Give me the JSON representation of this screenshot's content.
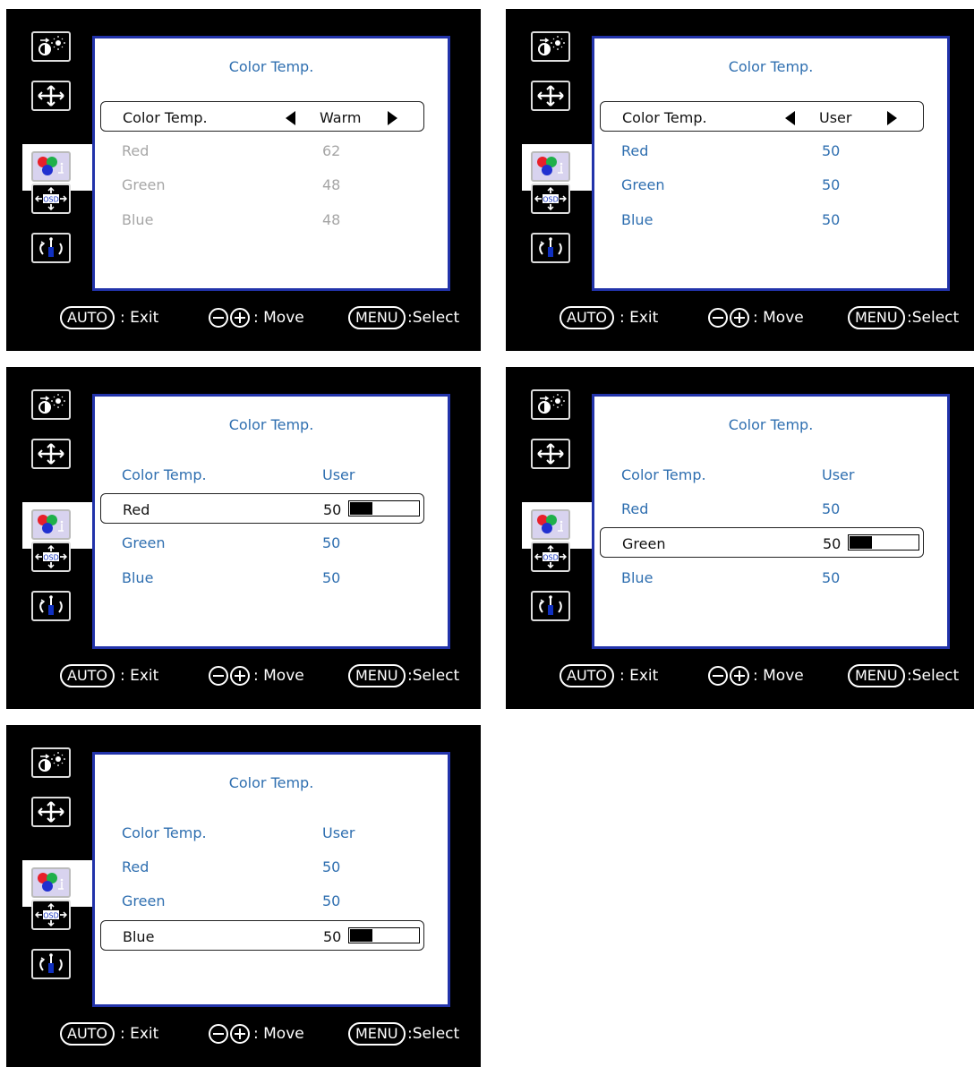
{
  "footer": {
    "auto": "AUTO",
    "exit": ": Exit",
    "move": ": Move",
    "menu": "MENU",
    "select": ":Select"
  },
  "icons": [
    "picture-icon",
    "position-icon",
    "color-icon",
    "osd-icon",
    "reset-icon"
  ],
  "screens": [
    {
      "title": "Color Temp.",
      "mode": "enum",
      "rows": [
        {
          "label": "Color Temp.",
          "value": "Warm",
          "state": "selected",
          "arrows": true
        },
        {
          "label": "Red",
          "value": "62",
          "state": "dim"
        },
        {
          "label": "Green",
          "value": "48",
          "state": "dim"
        },
        {
          "label": "Blue",
          "value": "48",
          "state": "dim"
        }
      ]
    },
    {
      "title": "Color Temp.",
      "mode": "enum",
      "rows": [
        {
          "label": "Color Temp.",
          "value": "User",
          "state": "selected",
          "arrows": true
        },
        {
          "label": "Red",
          "value": "50",
          "state": "normal"
        },
        {
          "label": "Green",
          "value": "50",
          "state": "normal"
        },
        {
          "label": "Blue",
          "value": "50",
          "state": "normal"
        }
      ]
    },
    {
      "title": "Color Temp.",
      "mode": "slider",
      "rows": [
        {
          "label": "Color Temp.",
          "value": "User",
          "state": "normal"
        },
        {
          "label": "Red",
          "value": "50",
          "state": "selected",
          "level": 0.5
        },
        {
          "label": "Green",
          "value": "50",
          "state": "normal"
        },
        {
          "label": "Blue",
          "value": "50",
          "state": "normal"
        }
      ]
    },
    {
      "title": "Color Temp.",
      "mode": "slider",
      "rows": [
        {
          "label": "Color Temp.",
          "value": "User",
          "state": "normal"
        },
        {
          "label": "Red",
          "value": "50",
          "state": "normal"
        },
        {
          "label": "Green",
          "value": "50",
          "state": "selected",
          "level": 0.5
        },
        {
          "label": "Blue",
          "value": "50",
          "state": "normal"
        }
      ]
    },
    {
      "title": "Color Temp.",
      "mode": "slider",
      "rows": [
        {
          "label": "Color Temp.",
          "value": "User",
          "state": "normal"
        },
        {
          "label": "Red",
          "value": "50",
          "state": "normal"
        },
        {
          "label": "Green",
          "value": "50",
          "state": "normal"
        },
        {
          "label": "Blue",
          "value": "50",
          "state": "selected",
          "level": 0.5
        }
      ]
    }
  ]
}
